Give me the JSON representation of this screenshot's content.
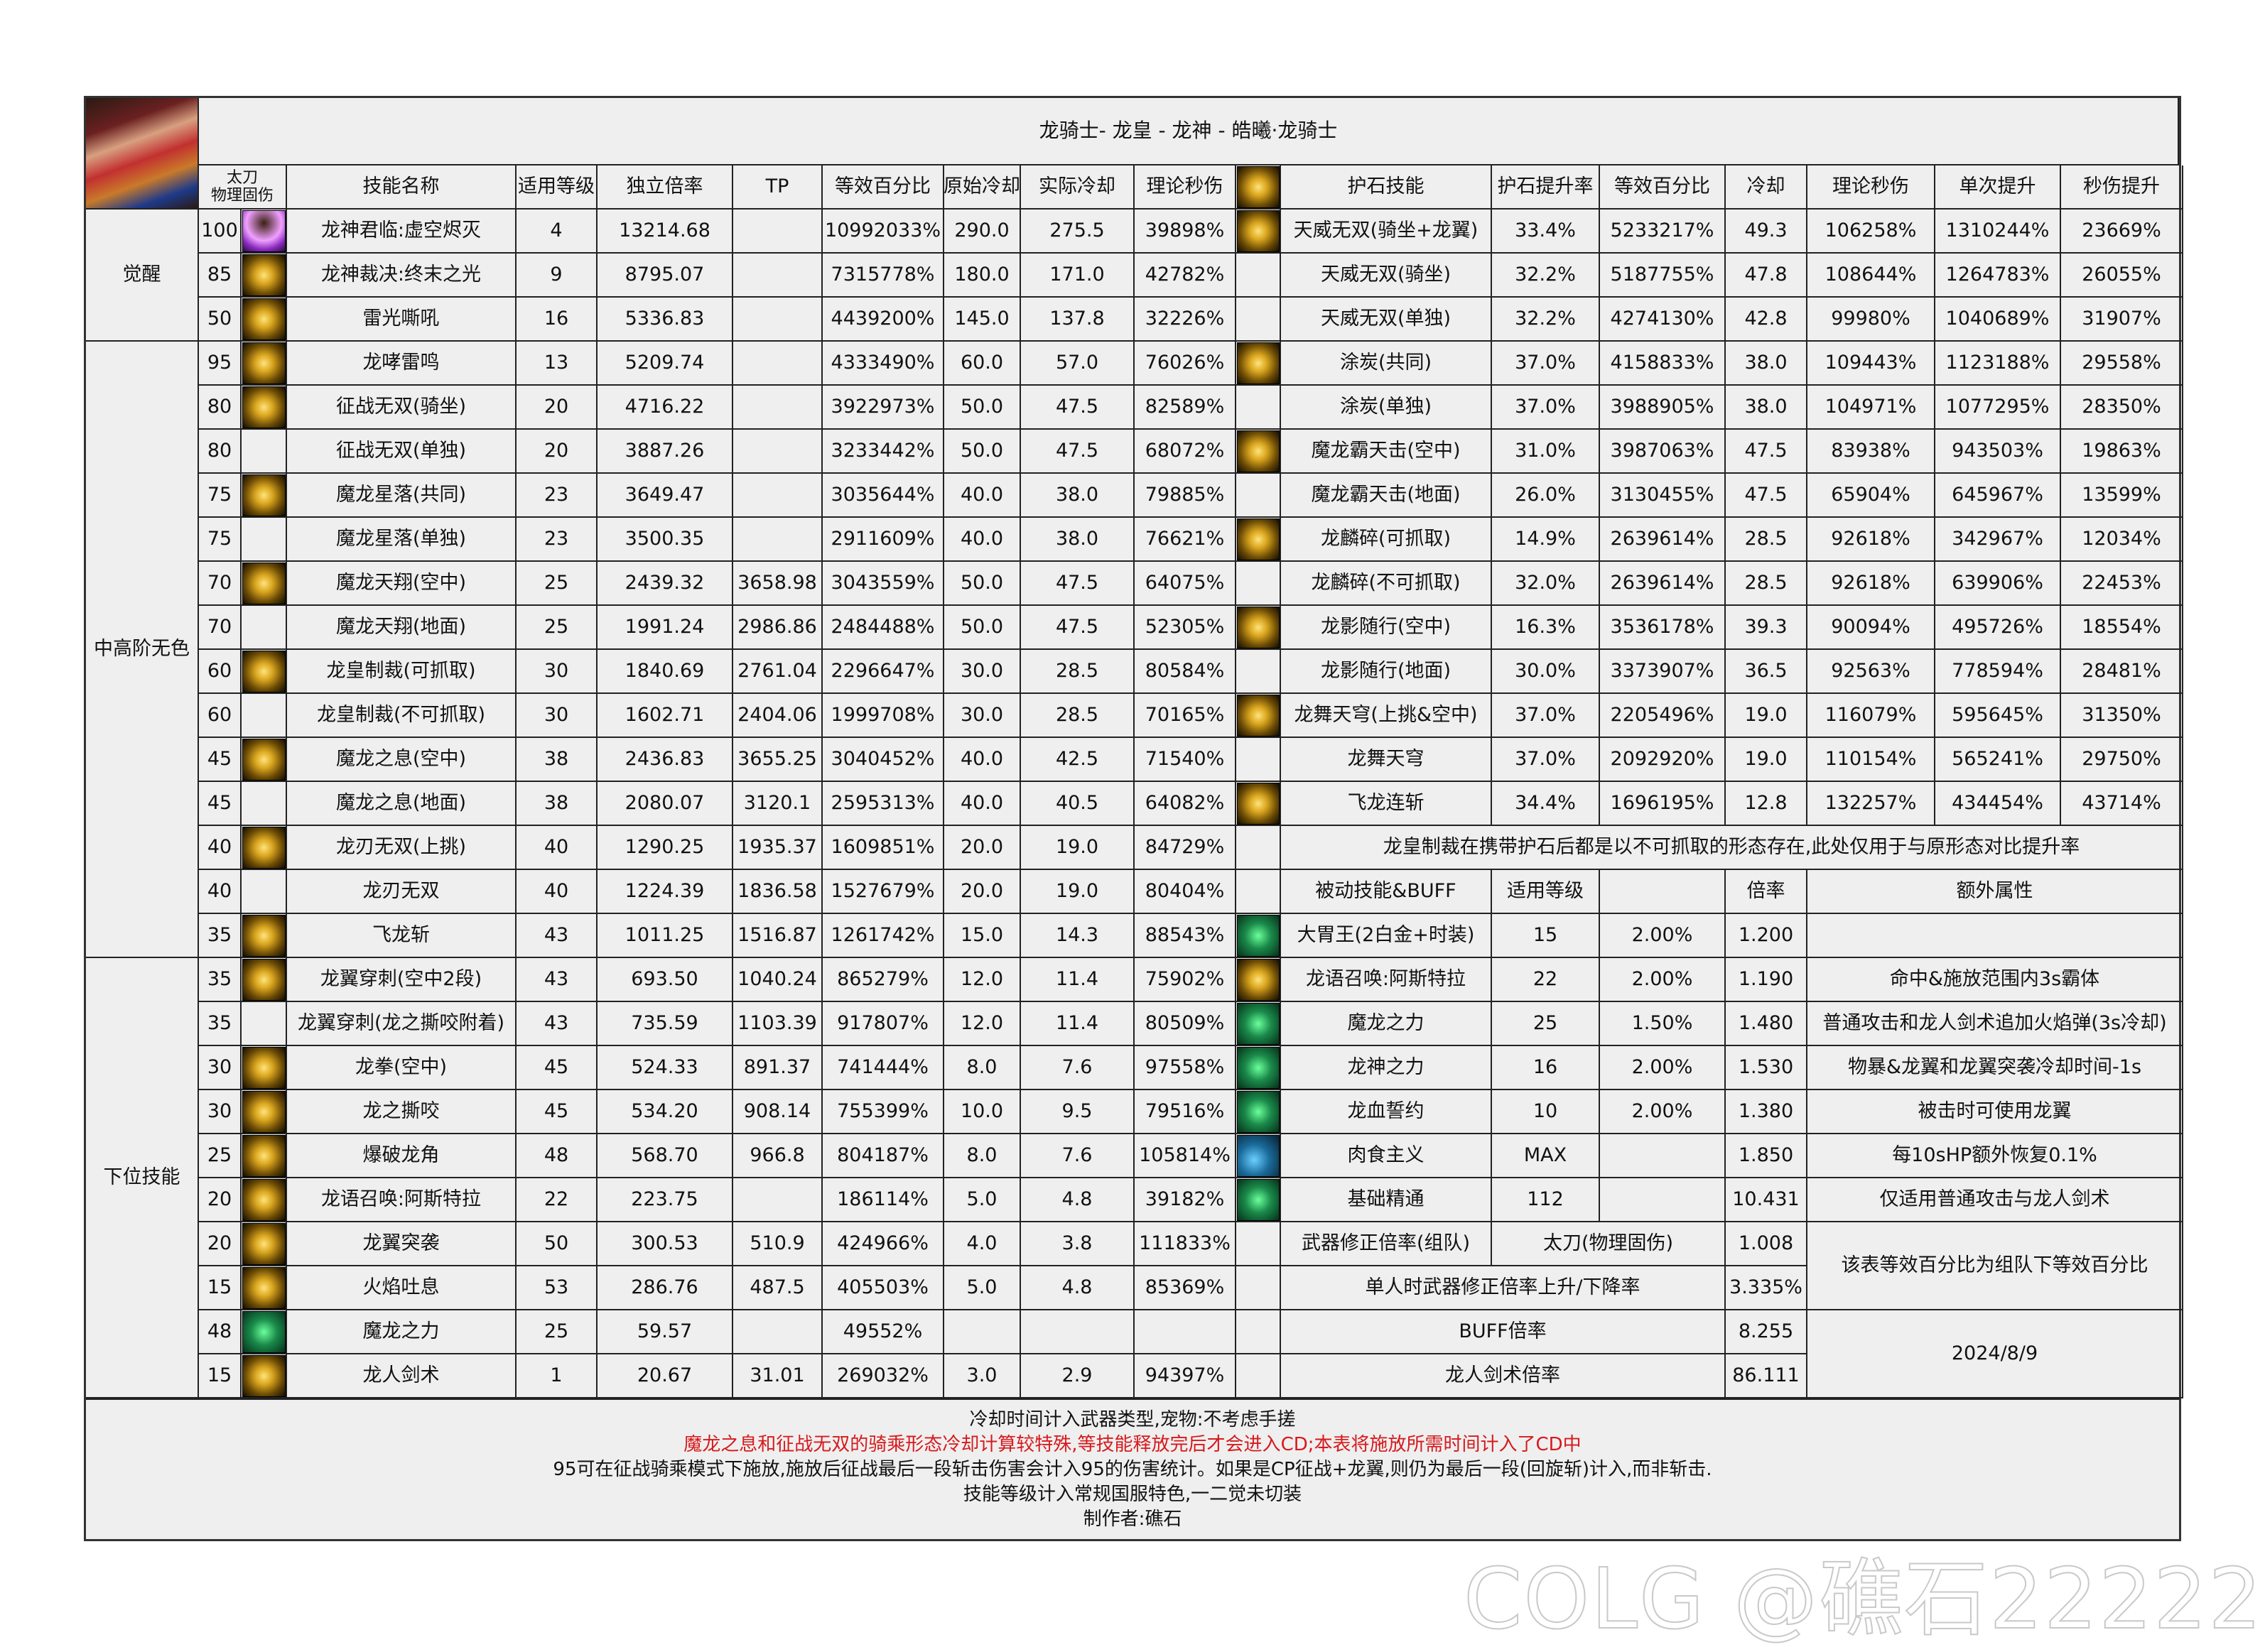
{
  "title": "龙骑士- 龙皇 - 龙神 - 皓曦·龙骑士",
  "header": {
    "weapon": "太刀\n物理固伤",
    "skill_name": "技能名称",
    "level": "适用等级",
    "ratio": "独立倍率",
    "tp": "TP",
    "equiv": "等效百分比",
    "orig_cd": "原始冷却",
    "real_cd": "实际冷却",
    "dps": "理论秒伤",
    "talisman": "护石技能",
    "t_rate": "护石提升率",
    "t_equiv": "等效百分比",
    "t_cd": "冷却",
    "t_dps": "理论秒伤",
    "t_single": "单次提升",
    "t_dps_up": "秒伤提升"
  },
  "sections": [
    {
      "label": "觉醒",
      "rows": 3
    },
    {
      "label": "中高阶无色",
      "rows": 14
    },
    {
      "label": "下位技能",
      "rows": 10
    }
  ],
  "skills": [
    {
      "lv": "100",
      "icon": "purple-awakening",
      "name": "龙神君临:虚空烬灭",
      "use": "4",
      "ratio": "13214.68",
      "tp": "",
      "equiv": "10992033%",
      "ocd": "290.0",
      "rcd": "275.5",
      "dps": "39898%"
    },
    {
      "lv": "85",
      "icon": "gold",
      "name": "龙神裁决:终末之光",
      "use": "9",
      "ratio": "8795.07",
      "tp": "",
      "equiv": "7315778%",
      "ocd": "180.0",
      "rcd": "171.0",
      "dps": "42782%"
    },
    {
      "lv": "50",
      "icon": "gold",
      "name": "雷光嘶吼",
      "use": "16",
      "ratio": "5336.83",
      "tp": "",
      "equiv": "4439200%",
      "ocd": "145.0",
      "rcd": "137.8",
      "dps": "32226%"
    },
    {
      "lv": "95",
      "icon": "gold",
      "name": "龙哮雷鸣",
      "use": "13",
      "ratio": "5209.74",
      "tp": "",
      "equiv": "4333490%",
      "ocd": "60.0",
      "rcd": "57.0",
      "dps": "76026%"
    },
    {
      "lv": "80",
      "icon": "gold",
      "name": "征战无双(骑坐)",
      "use": "20",
      "ratio": "4716.22",
      "tp": "",
      "equiv": "3922973%",
      "ocd": "50.0",
      "rcd": "47.5",
      "dps": "82589%"
    },
    {
      "lv": "80",
      "icon": "",
      "name": "征战无双(单独)",
      "use": "20",
      "ratio": "3887.26",
      "tp": "",
      "equiv": "3233442%",
      "ocd": "50.0",
      "rcd": "47.5",
      "dps": "68072%"
    },
    {
      "lv": "75",
      "icon": "gold",
      "name": "魔龙星落(共同)",
      "use": "23",
      "ratio": "3649.47",
      "tp": "",
      "equiv": "3035644%",
      "ocd": "40.0",
      "rcd": "38.0",
      "dps": "79885%"
    },
    {
      "lv": "75",
      "icon": "",
      "name": "魔龙星落(单独)",
      "use": "23",
      "ratio": "3500.35",
      "tp": "",
      "equiv": "2911609%",
      "ocd": "40.0",
      "rcd": "38.0",
      "dps": "76621%"
    },
    {
      "lv": "70",
      "icon": "gold",
      "name": "魔龙天翔(空中)",
      "use": "25",
      "ratio": "2439.32",
      "tp": "3658.98",
      "equiv": "3043559%",
      "ocd": "50.0",
      "rcd": "47.5",
      "dps": "64075%"
    },
    {
      "lv": "70",
      "icon": "",
      "name": "魔龙天翔(地面)",
      "use": "25",
      "ratio": "1991.24",
      "tp": "2986.86",
      "equiv": "2484488%",
      "ocd": "50.0",
      "rcd": "47.5",
      "dps": "52305%"
    },
    {
      "lv": "60",
      "icon": "gold",
      "name": "龙皇制裁(可抓取)",
      "use": "30",
      "ratio": "1840.69",
      "tp": "2761.04",
      "equiv": "2296647%",
      "ocd": "30.0",
      "rcd": "28.5",
      "dps": "80584%"
    },
    {
      "lv": "60",
      "icon": "",
      "name": "龙皇制裁(不可抓取)",
      "use": "30",
      "ratio": "1602.71",
      "tp": "2404.06",
      "equiv": "1999708%",
      "ocd": "30.0",
      "rcd": "28.5",
      "dps": "70165%"
    },
    {
      "lv": "45",
      "icon": "gold",
      "name": "魔龙之息(空中)",
      "use": "38",
      "ratio": "2436.83",
      "tp": "3655.25",
      "equiv": "3040452%",
      "ocd": "40.0",
      "rcd": "42.5",
      "dps": "71540%"
    },
    {
      "lv": "45",
      "icon": "",
      "name": "魔龙之息(地面)",
      "use": "38",
      "ratio": "2080.07",
      "tp": "3120.1",
      "equiv": "2595313%",
      "ocd": "40.0",
      "rcd": "40.5",
      "dps": "64082%"
    },
    {
      "lv": "40",
      "icon": "gold",
      "name": "龙刃无双(上挑)",
      "use": "40",
      "ratio": "1290.25",
      "tp": "1935.37",
      "equiv": "1609851%",
      "ocd": "20.0",
      "rcd": "19.0",
      "dps": "84729%"
    },
    {
      "lv": "40",
      "icon": "",
      "name": "龙刃无双",
      "use": "40",
      "ratio": "1224.39",
      "tp": "1836.58",
      "equiv": "1527679%",
      "ocd": "20.0",
      "rcd": "19.0",
      "dps": "80404%"
    },
    {
      "lv": "35",
      "icon": "gold",
      "name": "飞龙斩",
      "use": "43",
      "ratio": "1011.25",
      "tp": "1516.87",
      "equiv": "1261742%",
      "ocd": "15.0",
      "rcd": "14.3",
      "dps": "88543%"
    },
    {
      "lv": "35",
      "icon": "gold",
      "name": "龙翼穿刺(空中2段)",
      "use": "43",
      "ratio": "693.50",
      "tp": "1040.24",
      "equiv": "865279%",
      "ocd": "12.0",
      "rcd": "11.4",
      "dps": "75902%"
    },
    {
      "lv": "35",
      "icon": "",
      "name": "龙翼穿刺(龙之撕咬附着)",
      "use": "43",
      "ratio": "735.59",
      "tp": "1103.39",
      "equiv": "917807%",
      "ocd": "12.0",
      "rcd": "11.4",
      "dps": "80509%"
    },
    {
      "lv": "30",
      "icon": "gold",
      "name": "龙拳(空中)",
      "use": "45",
      "ratio": "524.33",
      "tp": "891.37",
      "equiv": "741444%",
      "ocd": "8.0",
      "rcd": "7.6",
      "dps": "97558%"
    },
    {
      "lv": "30",
      "icon": "gold",
      "name": "龙之撕咬",
      "use": "45",
      "ratio": "534.20",
      "tp": "908.14",
      "equiv": "755399%",
      "ocd": "10.0",
      "rcd": "9.5",
      "dps": "79516%"
    },
    {
      "lv": "25",
      "icon": "gold",
      "name": "爆破龙角",
      "use": "48",
      "ratio": "568.70",
      "tp": "966.8",
      "equiv": "804187%",
      "ocd": "8.0",
      "rcd": "7.6",
      "dps": "105814%"
    },
    {
      "lv": "20",
      "icon": "gold",
      "name": "龙语召唤:阿斯特拉",
      "use": "22",
      "ratio": "223.75",
      "tp": "",
      "equiv": "186114%",
      "ocd": "5.0",
      "rcd": "4.8",
      "dps": "39182%"
    },
    {
      "lv": "20",
      "icon": "gold",
      "name": "龙翼突袭",
      "use": "50",
      "ratio": "300.53",
      "tp": "510.9",
      "equiv": "424966%",
      "ocd": "4.0",
      "rcd": "3.8",
      "dps": "111833%"
    },
    {
      "lv": "15",
      "icon": "gold",
      "name": "火焰吐息",
      "use": "53",
      "ratio": "286.76",
      "tp": "487.5",
      "equiv": "405503%",
      "ocd": "5.0",
      "rcd": "4.8",
      "dps": "85369%"
    },
    {
      "lv": "48",
      "icon": "green",
      "name": "魔龙之力",
      "use": "25",
      "ratio": "59.57",
      "tp": "",
      "equiv": "49552%",
      "ocd": "",
      "rcd": "",
      "dps": ""
    },
    {
      "lv": "15",
      "icon": "gold",
      "name": "龙人剑术",
      "use": "1",
      "ratio": "20.67",
      "tp": "31.01",
      "equiv": "269032%",
      "ocd": "3.0",
      "rcd": "2.9",
      "dps": "94397%"
    }
  ],
  "talismans": [
    {
      "icon": "gold",
      "name": "天威无双(骑坐+龙翼)",
      "rate": "33.4%",
      "equiv": "5233217%",
      "cd": "49.3",
      "dps": "106258%",
      "single": "1310244%",
      "up": "23669%"
    },
    {
      "icon": "",
      "name": "天威无双(骑坐)",
      "rate": "32.2%",
      "equiv": "5187755%",
      "cd": "47.8",
      "dps": "108644%",
      "single": "1264783%",
      "up": "26055%"
    },
    {
      "icon": "",
      "name": "天威无双(单独)",
      "rate": "32.2%",
      "equiv": "4274130%",
      "cd": "42.8",
      "dps": "99980%",
      "single": "1040689%",
      "up": "31907%"
    },
    {
      "icon": "gold",
      "name": "涂炭(共同)",
      "rate": "37.0%",
      "equiv": "4158833%",
      "cd": "38.0",
      "dps": "109443%",
      "single": "1123188%",
      "up": "29558%"
    },
    {
      "icon": "",
      "name": "涂炭(单独)",
      "rate": "37.0%",
      "equiv": "3988905%",
      "cd": "38.0",
      "dps": "104971%",
      "single": "1077295%",
      "up": "28350%"
    },
    {
      "icon": "gold",
      "name": "魔龙霸天击(空中)",
      "rate": "31.0%",
      "equiv": "3987063%",
      "cd": "47.5",
      "dps": "83938%",
      "single": "943503%",
      "up": "19863%"
    },
    {
      "icon": "",
      "name": "魔龙霸天击(地面)",
      "rate": "26.0%",
      "equiv": "3130455%",
      "cd": "47.5",
      "dps": "65904%",
      "single": "645967%",
      "up": "13599%"
    },
    {
      "icon": "gold",
      "name": "龙麟碎(可抓取)",
      "rate": "14.9%",
      "equiv": "2639614%",
      "cd": "28.5",
      "dps": "92618%",
      "single": "342967%",
      "up": "12034%"
    },
    {
      "icon": "",
      "name": "龙麟碎(不可抓取)",
      "rate": "32.0%",
      "equiv": "2639614%",
      "cd": "28.5",
      "dps": "92618%",
      "single": "639906%",
      "up": "22453%"
    },
    {
      "icon": "gold",
      "name": "龙影随行(空中)",
      "rate": "16.3%",
      "equiv": "3536178%",
      "cd": "39.3",
      "dps": "90094%",
      "single": "495726%",
      "up": "18554%"
    },
    {
      "icon": "",
      "name": "龙影随行(地面)",
      "rate": "30.0%",
      "equiv": "3373907%",
      "cd": "36.5",
      "dps": "92563%",
      "single": "778594%",
      "up": "28481%"
    },
    {
      "icon": "gold",
      "name": "龙舞天穹(上挑&空中)",
      "rate": "37.0%",
      "equiv": "2205496%",
      "cd": "19.0",
      "dps": "116079%",
      "single": "595645%",
      "up": "31350%"
    },
    {
      "icon": "",
      "name": "龙舞天穹",
      "rate": "37.0%",
      "equiv": "2092920%",
      "cd": "19.0",
      "dps": "110154%",
      "single": "565241%",
      "up": "29750%"
    },
    {
      "icon": "gold",
      "name": "飞龙连斩",
      "rate": "34.4%",
      "equiv": "1696195%",
      "cd": "12.8",
      "dps": "132257%",
      "single": "434454%",
      "up": "43714%"
    }
  ],
  "talisman_note": "龙皇制裁在携带护石后都是以不可抓取的形态存在,此处仅用于与原形态对比提升率",
  "passive_header": {
    "name": "被动技能&BUFF",
    "level": "适用等级",
    "blank": "",
    "ratio": "倍率",
    "extra": "额外属性"
  },
  "passives": [
    {
      "icon": "green",
      "name": "大胃王(2白金+时装)",
      "level": "15",
      "pct": "2.00%",
      "ratio": "1.200",
      "extra": ""
    },
    {
      "icon": "gold",
      "name": "龙语召唤:阿斯特拉",
      "level": "22",
      "pct": "2.00%",
      "ratio": "1.190",
      "extra": "命中&施放范围内3s霸体"
    },
    {
      "icon": "green",
      "name": "魔龙之力",
      "level": "25",
      "pct": "1.50%",
      "ratio": "1.480",
      "extra": "普通攻击和龙人剑术追加火焰弹(3s冷却)"
    },
    {
      "icon": "green",
      "name": "龙神之力",
      "level": "16",
      "pct": "2.00%",
      "ratio": "1.530",
      "extra": "物暴&龙翼和龙翼突袭冷却时间-1s"
    },
    {
      "icon": "green",
      "name": "龙血誓约",
      "level": "10",
      "pct": "2.00%",
      "ratio": "1.380",
      "extra": "被击时可使用龙翼"
    },
    {
      "icon": "blue",
      "name": "肉食主义",
      "level": "MAX",
      "pct": "",
      "ratio": "1.850",
      "extra": "每10sHP额外恢复0.1%"
    },
    {
      "icon": "green",
      "name": "基础精通",
      "level": "112",
      "pct": "",
      "ratio": "10.431",
      "extra": "仅适用普通攻击与龙人剑术"
    }
  ],
  "weapon_fix": {
    "label": "武器修正倍率(组队)",
    "type": "太刀(物理固伤)",
    "value": "1.008"
  },
  "solo_fix": {
    "label": "单人时武器修正倍率上升/下降率",
    "value": "3.335%"
  },
  "buff_ratio": {
    "label": "BUFF倍率",
    "value": "8.255"
  },
  "sword_ratio": {
    "label": "龙人剑术倍率",
    "value": "86.111"
  },
  "team_note": "该表等效百分比为组队下等效百分比",
  "date": "2024/8/9",
  "footer": {
    "line1": "冷却时间计入武器类型,宠物:不考虑手搓",
    "line2": "魔龙之息和征战无双的骑乘形态冷却计算较特殊,等技能释放完后才会进入CD;本表将施放所需时间计入了CD中",
    "line3": "95可在征战骑乘模式下施放,施放后征战最后一段斩击伤害会计入95的伤害统计。如果是CP征战+龙翼,则仍为最后一段(回旋斩)计入,而非斩击.",
    "line4": "技能等级计入常规国服特色,一二觉未切装",
    "line5": "制作者:礁石"
  },
  "colors": {
    "warning_text": "#d7191c",
    "sheet_bg": "#efefef",
    "grid": "#222222"
  },
  "watermark": "COLG @礁石22222"
}
